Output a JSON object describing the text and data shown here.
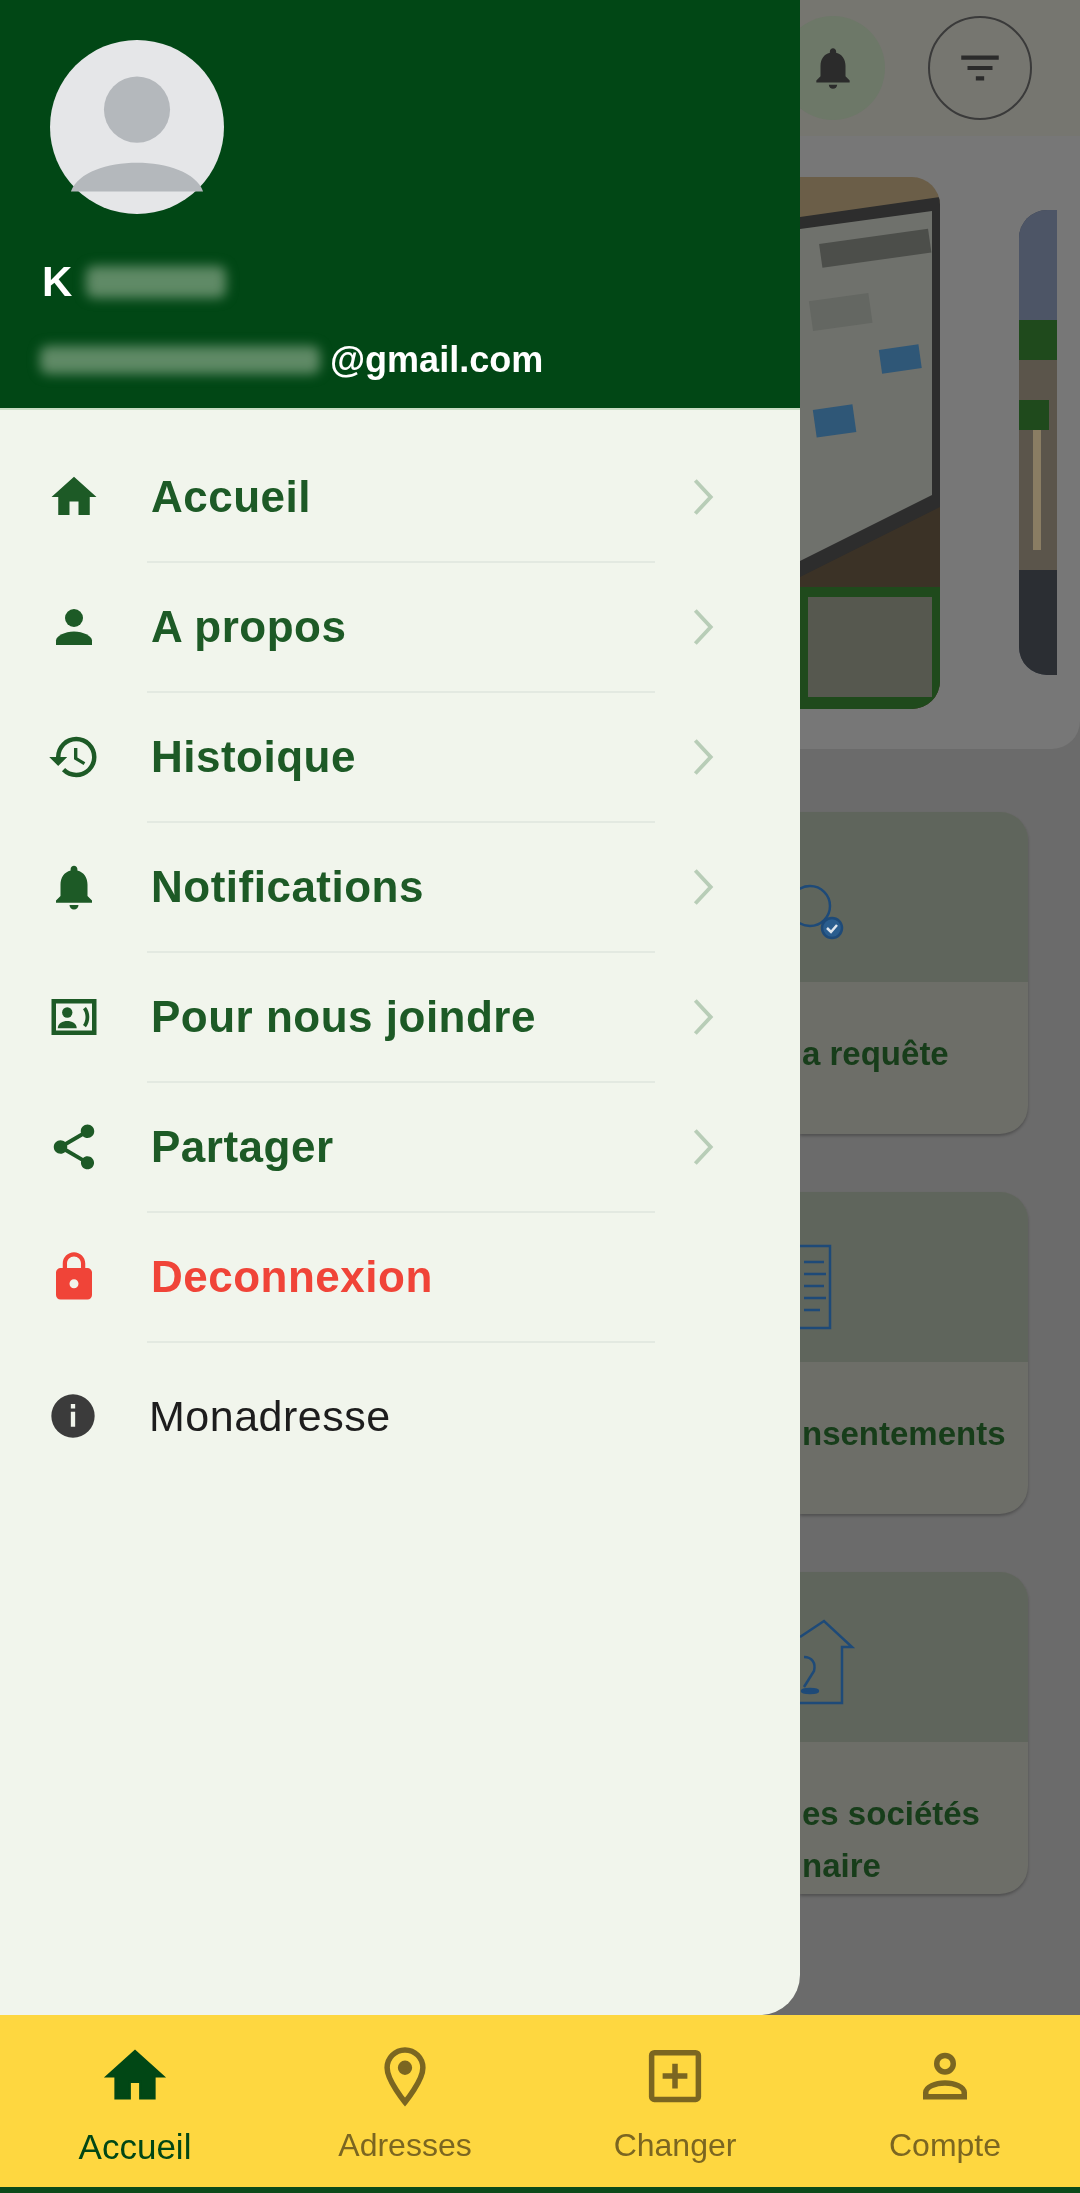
{
  "drawer": {
    "user": {
      "name": "K",
      "email": "@gmail.com"
    },
    "menu": [
      {
        "label": "Accueil",
        "kind": "nav"
      },
      {
        "label": "A propos",
        "kind": "nav"
      },
      {
        "label": "Histoique",
        "kind": "nav"
      },
      {
        "label": "Notifications",
        "kind": "nav"
      },
      {
        "label": "Pour nous joindre",
        "kind": "nav"
      },
      {
        "label": "Partager",
        "kind": "nav"
      },
      {
        "label": "Deconnexion",
        "kind": "danger"
      },
      {
        "label": "Monadresse",
        "kind": "info"
      }
    ]
  },
  "background": {
    "cards": [
      {
        "title_lines": [
          "a requête"
        ]
      },
      {
        "title_lines": [
          "nsentements"
        ]
      },
      {
        "title_lines": [
          "es sociétés",
          "naire"
        ]
      }
    ]
  },
  "bottom_nav": [
    {
      "label": "Accueil",
      "selected": true
    },
    {
      "label": "Adresses",
      "selected": false
    },
    {
      "label": "Changer",
      "selected": false
    },
    {
      "label": "Compte",
      "selected": false
    }
  ]
}
